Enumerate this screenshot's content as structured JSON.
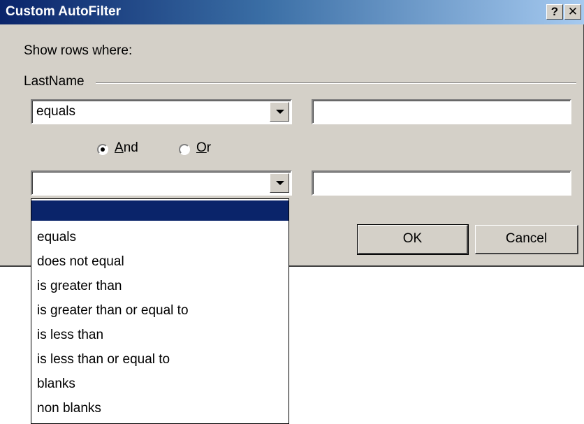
{
  "window": {
    "title": "Custom AutoFilter",
    "help_label": "?",
    "close_label": "✕"
  },
  "dialog": {
    "show_rows_label": "Show rows where:",
    "field_label": "LastName",
    "operator1": "equals",
    "value1": "",
    "and_label_u": "A",
    "and_label_rest": "nd",
    "or_label_u": "O",
    "or_label_rest": "r",
    "logic_selected": "And",
    "operator2": "",
    "value2": "",
    "ok_label": "OK",
    "cancel_label": "Cancel"
  },
  "dropdown": {
    "items": [
      "",
      "equals",
      "does not equal",
      "is greater than",
      "is greater than or equal to",
      "is less than",
      "is less than or equal to",
      "blanks",
      "non blanks"
    ],
    "selected_index": 0
  }
}
